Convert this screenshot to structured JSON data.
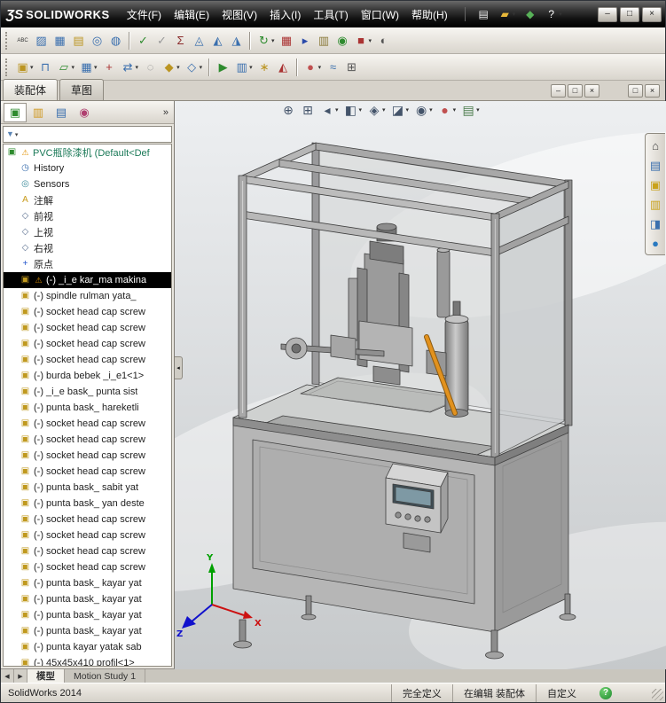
{
  "colors": {
    "titlebar_bg": "#0a0a0a",
    "selection_bg": "#000000",
    "tree_root_text": "#1b7a58",
    "viewport_top": "#edeff1",
    "viewport_bottom": "#c6c9cb",
    "highlight_part": "#e2921e",
    "triad_x": "#cc1111",
    "triad_y": "#00a000",
    "triad_z": "#1111cc"
  },
  "titlebar": {
    "logo_mark": "ƷS",
    "logo_text": "SOLIDWORKS",
    "menus": [
      {
        "label": "文件(F)",
        "name": "menu-file"
      },
      {
        "label": "编辑(E)",
        "name": "menu-edit"
      },
      {
        "label": "视图(V)",
        "name": "menu-view"
      },
      {
        "label": "插入(I)",
        "name": "menu-insert"
      },
      {
        "label": "工具(T)",
        "name": "menu-tools"
      },
      {
        "label": "窗口(W)",
        "name": "menu-window"
      },
      {
        "label": "帮助(H)",
        "name": "menu-help"
      }
    ],
    "quick_icons": [
      {
        "name": "new-document",
        "glyph": "▤",
        "color": "#f2f2f2"
      },
      {
        "name": "open-document",
        "glyph": "▰",
        "color": "#e8b83a",
        "caret": true
      },
      {
        "name": "toolbox",
        "glyph": "◆",
        "color": "#58b158"
      },
      {
        "name": "help",
        "glyph": "?",
        "color": "#ffffff",
        "caret": true
      }
    ],
    "window_buttons": [
      {
        "name": "minimize",
        "glyph": "–"
      },
      {
        "name": "maximize",
        "glyph": "□"
      },
      {
        "name": "close",
        "glyph": "×"
      }
    ]
  },
  "toolbar_row1": [
    {
      "name": "spell-check",
      "glyph": "ABC",
      "color": "#333333",
      "size": 6
    },
    {
      "name": "format-painter",
      "glyph": "▨",
      "color": "#3a6fae"
    },
    {
      "name": "design-table",
      "glyph": "▦",
      "color": "#3a6fae"
    },
    {
      "name": "note",
      "glyph": "▤",
      "color": "#bb9522"
    },
    {
      "name": "balloon",
      "glyph": "◎",
      "color": "#3a6fae"
    },
    {
      "name": "auto-balloon",
      "glyph": "◍",
      "color": "#3a6fae"
    },
    {
      "sep": true
    },
    {
      "name": "spell-ok",
      "glyph": "✓",
      "color": "#2e8b2e"
    },
    {
      "name": "check-inactive",
      "glyph": "✓",
      "color": "#999999"
    },
    {
      "name": "equations",
      "glyph": "Σ",
      "color": "#8a2a2a"
    },
    {
      "name": "measure",
      "glyph": "◬",
      "color": "#3a6fae"
    },
    {
      "name": "mass-properties",
      "glyph": "◭",
      "color": "#3a6fae"
    },
    {
      "name": "section-properties",
      "glyph": "◮",
      "color": "#3a6fae"
    },
    {
      "sep": true
    },
    {
      "name": "update-assembly",
      "glyph": "↻",
      "color": "#2e8b2e",
      "caret": true
    },
    {
      "name": "bom-table",
      "glyph": "▦",
      "color": "#aa3333"
    },
    {
      "name": "flag",
      "glyph": "▸",
      "color": "#2a4aaa"
    },
    {
      "name": "clipboard",
      "glyph": "▥",
      "color": "#8a7a3a"
    },
    {
      "name": "verification",
      "glyph": "◉",
      "color": "#2e8b2e"
    },
    {
      "name": "edit-color",
      "glyph": "■",
      "color": "#aa3333",
      "caret": true
    },
    {
      "name": "camera-view",
      "glyph": "◐",
      "color": "#555555"
    }
  ],
  "toolbar_row2": [
    {
      "name": "insert-component",
      "glyph": "▣",
      "color": "#bb9522",
      "caret": true
    },
    {
      "name": "mate",
      "glyph": "⊓",
      "color": "#3a6fae"
    },
    {
      "name": "sketch",
      "glyph": "▱",
      "color": "#2e8b2e",
      "caret": true
    },
    {
      "name": "linear-pattern",
      "glyph": "▦",
      "color": "#3a6fae",
      "caret": true
    },
    {
      "name": "smart-fasteners",
      "glyph": "+",
      "color": "#aa3333"
    },
    {
      "name": "move-component",
      "glyph": "⇄",
      "color": "#3a6fae",
      "caret": true
    },
    {
      "name": "show-hidden",
      "glyph": "◌",
      "color": "#888888"
    },
    {
      "name": "assembly-features",
      "glyph": "◆",
      "color": "#bb9522",
      "caret": true
    },
    {
      "name": "reference-geometry",
      "glyph": "◇",
      "color": "#3a6fae",
      "caret": true
    },
    {
      "sep": true
    },
    {
      "name": "motion-study",
      "glyph": "▶",
      "color": "#2e8b2e"
    },
    {
      "name": "bill-of-materials",
      "glyph": "▥",
      "color": "#3a6fae",
      "caret": true
    },
    {
      "name": "exploded-view",
      "glyph": "∗",
      "color": "#bb9522"
    },
    {
      "name": "interference-detection",
      "glyph": "◭",
      "color": "#aa3333"
    },
    {
      "sep": true
    },
    {
      "name": "appearances",
      "glyph": "●",
      "color": "#c05050",
      "caret": true
    },
    {
      "name": "simulation",
      "glyph": "≈",
      "color": "#3a6fae"
    },
    {
      "name": "grid-settings",
      "glyph": "⊞",
      "color": "#555555"
    }
  ],
  "command_bar": {
    "tabs": [
      {
        "label": "装配体",
        "name": "tab-assembly",
        "active": true
      },
      {
        "label": "草图",
        "name": "tab-sketch",
        "active": false
      }
    ],
    "doc_window_buttons": [
      {
        "name": "doc-minimize",
        "glyph": "–"
      },
      {
        "name": "doc-restore",
        "glyph": "□"
      },
      {
        "name": "doc-close",
        "glyph": "×"
      }
    ],
    "pane_buttons": [
      {
        "name": "pane-restore",
        "glyph": "□"
      },
      {
        "name": "pane-close",
        "glyph": "×"
      }
    ]
  },
  "feature_tree": {
    "chevron": "»",
    "filter_glyph": "▼",
    "filter_caret": "▾",
    "panel_tabs": [
      {
        "name": "featuremanager-tab",
        "glyph": "▣",
        "color": "#2e8b2e"
      },
      {
        "name": "propertymanager-tab",
        "glyph": "▥",
        "color": "#d09820"
      },
      {
        "name": "configurationmanager-tab",
        "glyph": "▤",
        "color": "#3a6fae"
      },
      {
        "name": "displaymanager-tab",
        "glyph": "◉",
        "color": "#b04070"
      }
    ],
    "icon_defs": {
      "assembly": {
        "glyph": "▣",
        "color": "#2e8b2e"
      },
      "history": {
        "glyph": "◷",
        "color": "#3a6fae"
      },
      "sensors": {
        "glyph": "◎",
        "color": "#3a8a9a"
      },
      "annotations": {
        "glyph": "A",
        "color": "#c89a1a"
      },
      "plane": {
        "glyph": "◇",
        "color": "#5a6f8f"
      },
      "origin": {
        "glyph": "+",
        "color": "#2255cc"
      },
      "component": {
        "glyph": "▣",
        "color": "#c0991f"
      },
      "warn": {
        "glyph": "⚠",
        "color": "#e09000"
      }
    },
    "items": [
      {
        "icon": "assembly",
        "root": true,
        "warn": true,
        "label": "PVC瓶除漆机 (Default<Def"
      },
      {
        "icon": "history",
        "label": "History"
      },
      {
        "icon": "sensors",
        "label": "Sensors"
      },
      {
        "icon": "annotations",
        "label": "注解"
      },
      {
        "icon": "plane",
        "label": "前视"
      },
      {
        "icon": "plane",
        "label": "上视"
      },
      {
        "icon": "plane",
        "label": "右视"
      },
      {
        "icon": "origin",
        "label": "原点"
      },
      {
        "icon": "component",
        "warn": true,
        "sel": true,
        "label": "(-) _i_e kar_ma makina"
      },
      {
        "icon": "component",
        "label": "(-) spindle rulman yata_"
      },
      {
        "icon": "component",
        "label": "(-) socket head cap screw"
      },
      {
        "icon": "component",
        "label": "(-) socket head cap screw"
      },
      {
        "icon": "component",
        "label": "(-) socket head cap screw"
      },
      {
        "icon": "component",
        "label": "(-) socket head cap screw"
      },
      {
        "icon": "component",
        "label": "(-) burda bebek _i_e1<1>"
      },
      {
        "icon": "component",
        "label": "(-) _i_e bask_ punta sist"
      },
      {
        "icon": "component",
        "label": "(-) punta bask_ hareketli"
      },
      {
        "icon": "component",
        "label": "(-) socket head cap screw"
      },
      {
        "icon": "component",
        "label": "(-) socket head cap screw"
      },
      {
        "icon": "component",
        "label": "(-) socket head cap screw"
      },
      {
        "icon": "component",
        "label": "(-) socket head cap screw"
      },
      {
        "icon": "component",
        "label": "(-) punta bask_ sabit yat"
      },
      {
        "icon": "component",
        "label": "(-) punta bask_ yan deste"
      },
      {
        "icon": "component",
        "label": "(-) socket head cap screw"
      },
      {
        "icon": "component",
        "label": "(-) socket head cap screw"
      },
      {
        "icon": "component",
        "label": "(-) socket head cap screw"
      },
      {
        "icon": "component",
        "label": "(-) socket head cap screw"
      },
      {
        "icon": "component",
        "label": "(-) punta bask_ kayar yat"
      },
      {
        "icon": "component",
        "label": "(-) punta bask_ kayar yat"
      },
      {
        "icon": "component",
        "label": "(-) punta bask_ kayar yat"
      },
      {
        "icon": "component",
        "label": "(-) punta bask_ kayar yat"
      },
      {
        "icon": "component",
        "label": "(-) punta kayar yatak sab"
      },
      {
        "icon": "component",
        "label": "(-) 45x45x410 profil<1>"
      }
    ]
  },
  "viewport": {
    "collapse_glyph": "◂",
    "headsup": [
      {
        "name": "zoom-fit",
        "glyph": "⊕",
        "color": "#44546a"
      },
      {
        "name": "zoom-area",
        "glyph": "⊞",
        "color": "#44546a"
      },
      {
        "name": "previous-view",
        "glyph": "◂",
        "color": "#44546a",
        "caret": true
      },
      {
        "name": "section-view",
        "glyph": "◧",
        "color": "#44546a",
        "caret": true
      },
      {
        "name": "view-orientation",
        "glyph": "◈",
        "color": "#44546a",
        "caret": true
      },
      {
        "name": "display-style",
        "glyph": "◪",
        "color": "#44546a",
        "caret": true
      },
      {
        "name": "hide-show-items",
        "glyph": "◉",
        "color": "#44546a",
        "caret": true
      },
      {
        "name": "edit-appearance",
        "glyph": "●",
        "color": "#c05050",
        "caret": true
      },
      {
        "name": "apply-scene",
        "glyph": "▤",
        "color": "#4a7a4a",
        "caret": true
      }
    ],
    "taskpane": [
      {
        "name": "home",
        "glyph": "⌂",
        "color": "#444444"
      },
      {
        "name": "solidworks-resources",
        "glyph": "▤",
        "color": "#3a6fae"
      },
      {
        "name": "design-library",
        "glyph": "▣",
        "color": "#caa21a"
      },
      {
        "name": "file-explorer",
        "glyph": "▥",
        "color": "#caa21a"
      },
      {
        "name": "view-palette",
        "glyph": "◨",
        "color": "#3a6fae"
      },
      {
        "name": "appearances-scenes",
        "glyph": "●",
        "color": "#2a7ac0"
      }
    ],
    "triad": {
      "x": "X",
      "y": "Y",
      "z": "Z"
    }
  },
  "doc_tabs": {
    "nav": [
      "◀",
      "▶"
    ],
    "tabs": [
      {
        "label": "模型",
        "name": "doc-tab-model",
        "active": true
      },
      {
        "label": "Motion Study 1",
        "name": "doc-tab-motion-study",
        "active": false
      }
    ]
  },
  "statusbar": {
    "app_version": "SolidWorks 2014",
    "define_status": "完全定义",
    "edit_status": "在编辑 装配体",
    "custom_label": "自定义",
    "help_glyph": "?"
  }
}
